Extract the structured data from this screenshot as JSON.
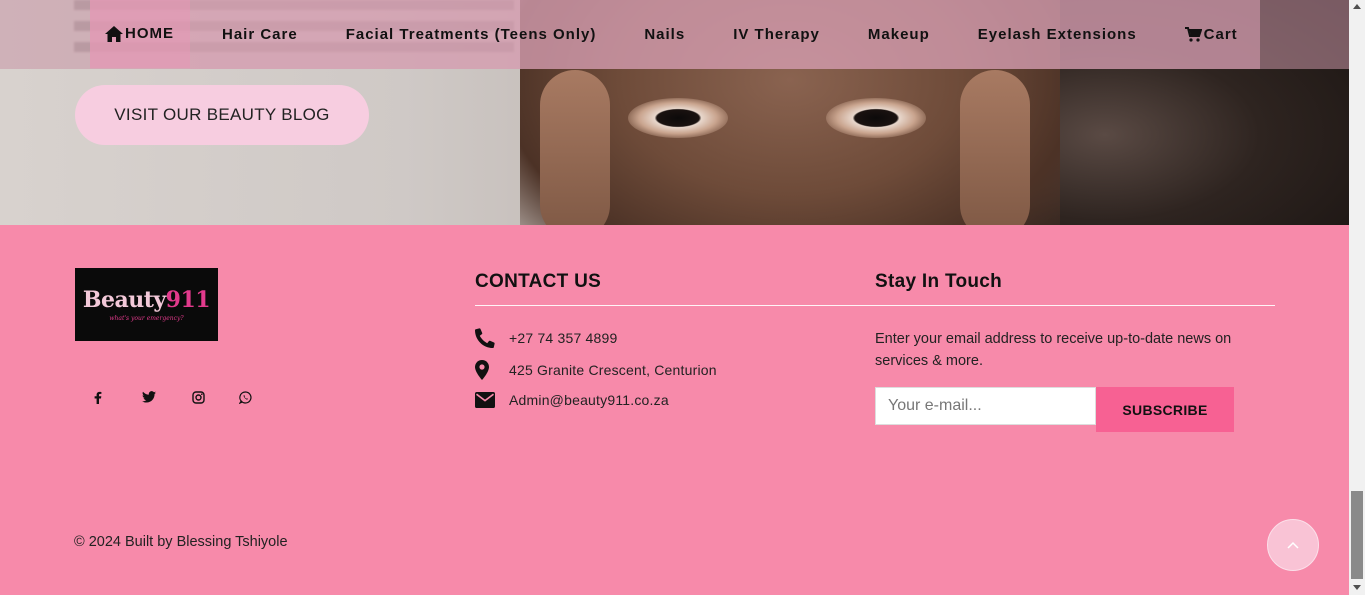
{
  "nav": {
    "items": [
      {
        "label": "HOME",
        "icon": "home-icon"
      },
      {
        "label": "Hair Care"
      },
      {
        "label": "Facial Treatments (Teens Only)"
      },
      {
        "label": "Nails"
      },
      {
        "label": "IV Therapy"
      },
      {
        "label": "Makeup"
      },
      {
        "label": "Eyelash Extensions"
      },
      {
        "label": "Cart",
        "icon": "cart-icon"
      }
    ]
  },
  "hero": {
    "blog_button": "VISIT OUR BEAUTY BLOG"
  },
  "logo": {
    "brand_word": "Beauty",
    "brand_num": "911",
    "tagline": "what's your emergency?"
  },
  "social": [
    "facebook-icon",
    "twitter-icon",
    "instagram-icon",
    "whatsapp-icon"
  ],
  "contact": {
    "title": "CONTACT US",
    "phone": "+27 74 357 4899",
    "address": "425 Granite Crescent, Centurion",
    "email": "Admin@beauty911.co.za"
  },
  "newsletter": {
    "title": "Stay In Touch",
    "text": "Enter your email address to receive up-to-date news on services & more.",
    "placeholder": "Your e-mail...",
    "button": "SUBSCRIBE"
  },
  "footer": {
    "copyright": "© 2024 Built by Blessing Tshiyole"
  },
  "colors": {
    "footer_bg": "#f78aaa",
    "subscribe_bg": "#f76193",
    "blog_button_bg": "#f7cde0"
  }
}
